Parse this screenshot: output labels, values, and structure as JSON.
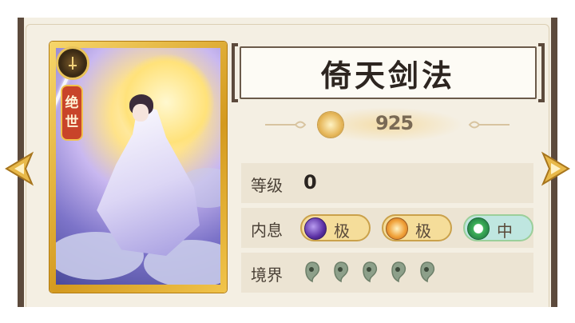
{
  "skill": {
    "name": "倚天剑法",
    "rarity": [
      "绝",
      "世"
    ],
    "power": "925"
  },
  "stats": {
    "level": {
      "label": "等级",
      "value": "0"
    },
    "neixi": {
      "label": "内息",
      "items": [
        {
          "icon": "purple-orb-icon",
          "grade": "极"
        },
        {
          "icon": "sun-orb-icon",
          "grade": "极"
        },
        {
          "icon": "green-orb-icon",
          "grade": "中"
        }
      ]
    },
    "jingjie": {
      "label": "境界",
      "count": 5,
      "icon": "spirit-drop-icon"
    }
  },
  "colors": {
    "panel": "#f4efe3",
    "frame": "#5c4a3c",
    "gold": "#e8c25a",
    "rarity_red": "#c8442a"
  }
}
